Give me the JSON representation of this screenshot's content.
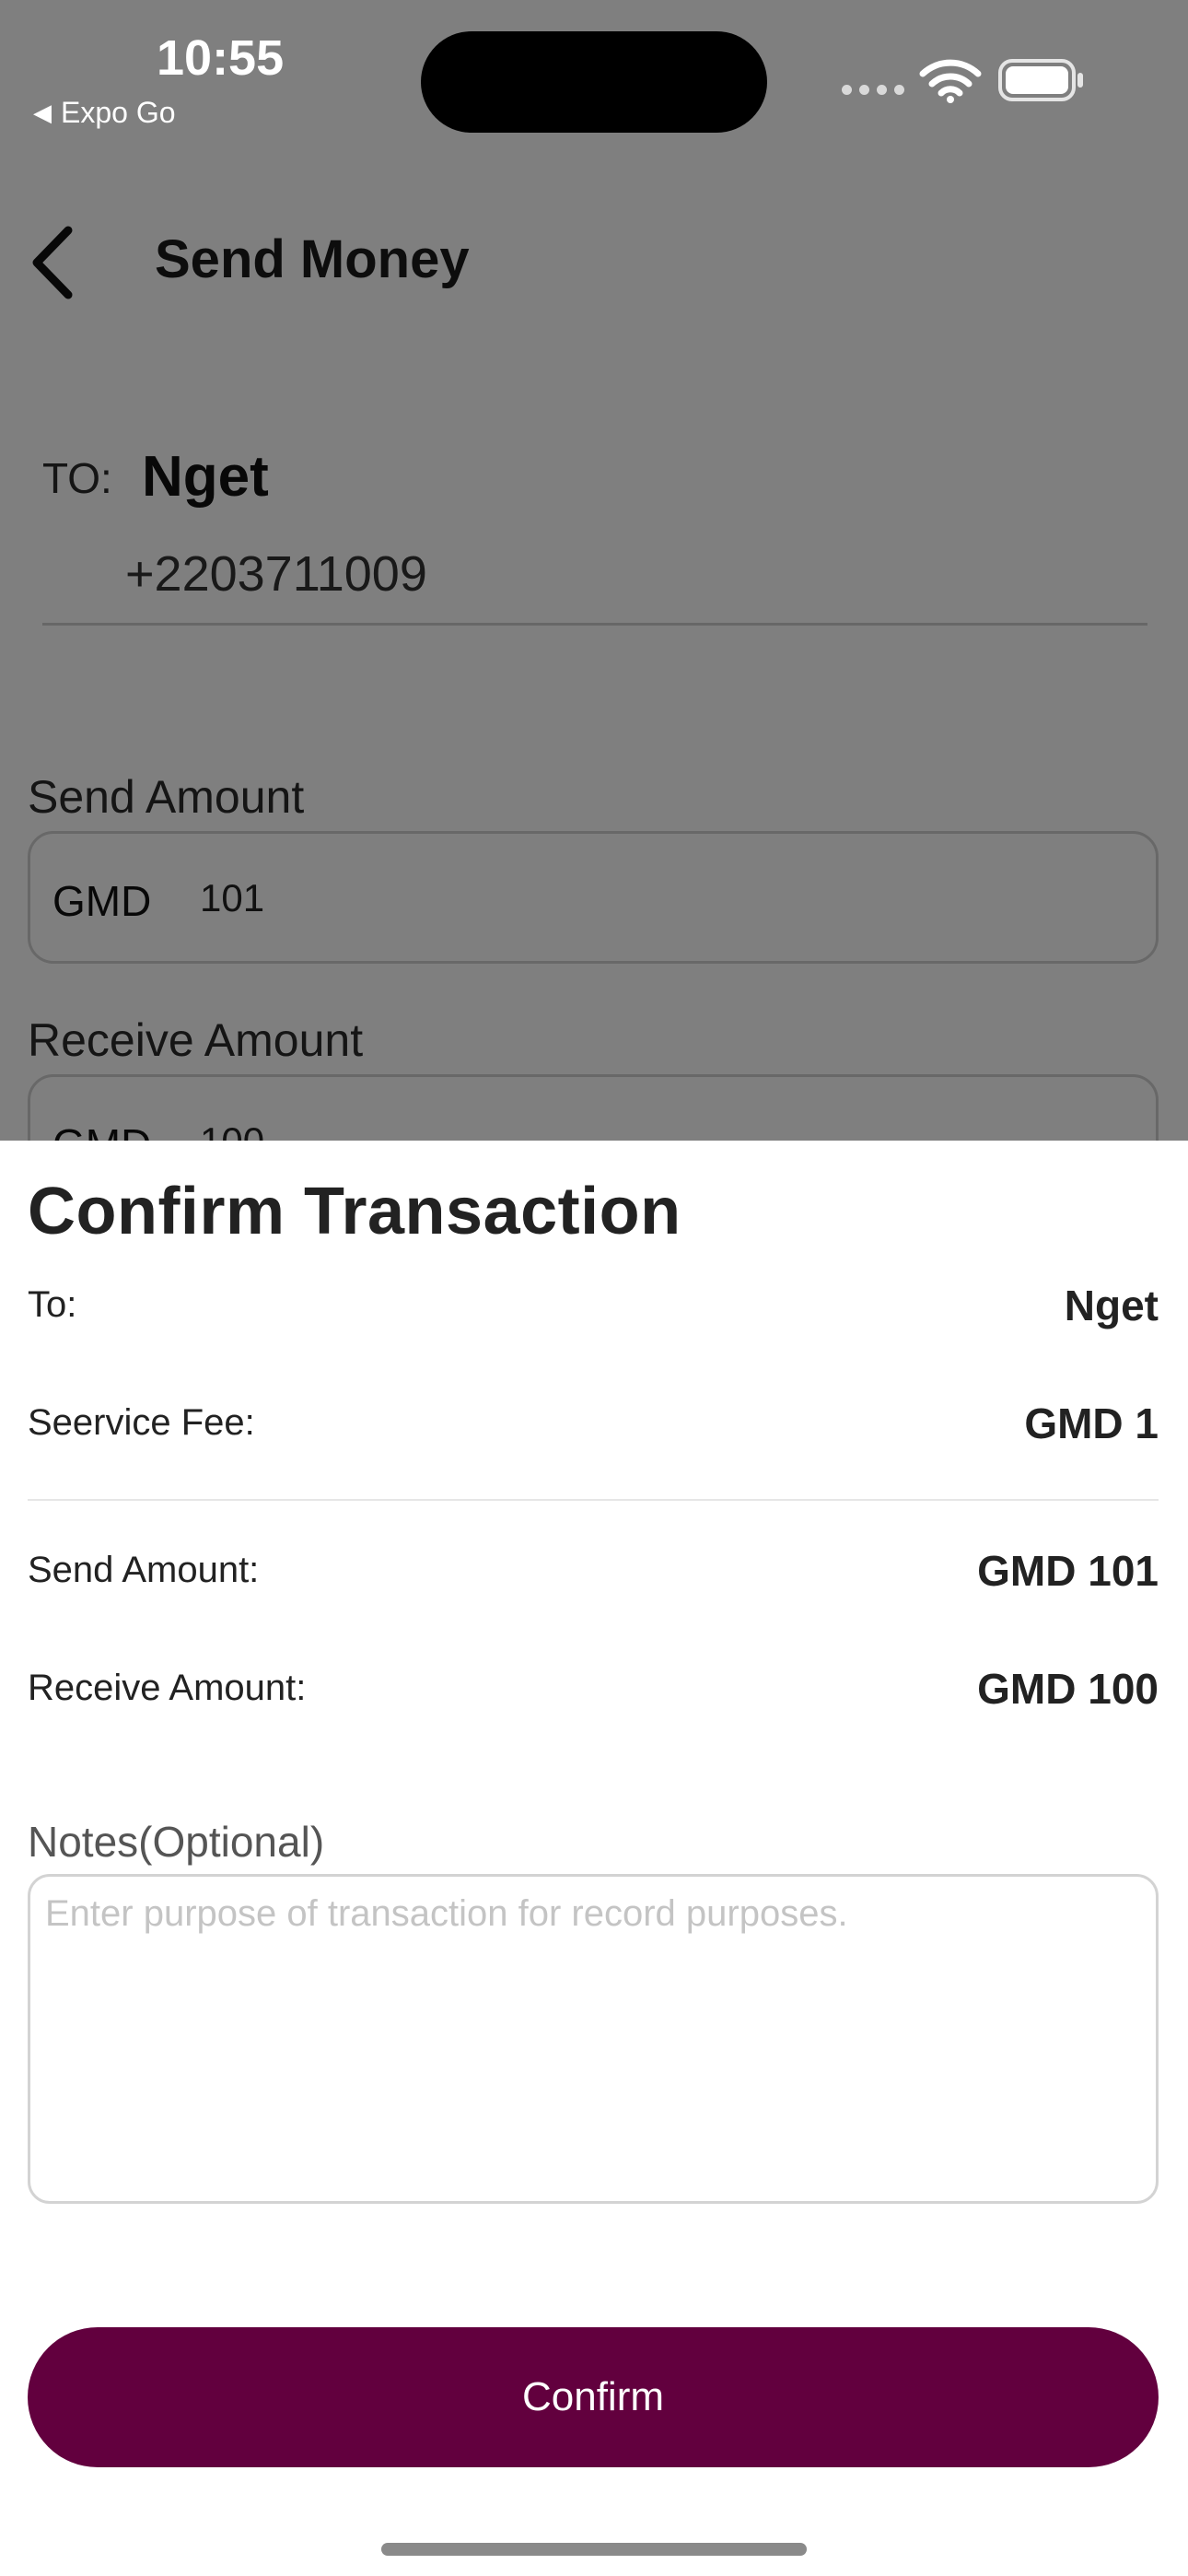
{
  "status_bar": {
    "time": "10:55",
    "back_app_label": "Expo Go",
    "back_app_icon": "triangle-left-icon",
    "wifi_icon": "wifi-icon",
    "battery_icon": "battery-icon"
  },
  "header": {
    "back_icon": "chevron-left-icon",
    "title": "Send Money"
  },
  "recipient": {
    "to_label": "TO:",
    "name": "Nget",
    "phone": "+2203711009"
  },
  "send_amount": {
    "label": "Send Amount",
    "currency": "GMD",
    "value": "101"
  },
  "receive_amount": {
    "label": "Receive Amount",
    "currency": "GMD",
    "value": "100"
  },
  "confirm_sheet": {
    "title": "Confirm Transaction",
    "rows": [
      {
        "label": "To:",
        "value": "Nget"
      },
      {
        "label": "Seervice Fee:",
        "value": "GMD 1"
      },
      {
        "label": "Send Amount:",
        "value": "GMD 101"
      },
      {
        "label": "Receive Amount:",
        "value": "GMD 100"
      }
    ],
    "notes_label": "Notes(Optional)",
    "notes_placeholder": "Enter purpose of transaction for record purposes.",
    "notes_value": "",
    "confirm_label": "Confirm"
  },
  "colors": {
    "primary": "#62003e",
    "overlay": "rgba(0,0,0,0.5)"
  }
}
